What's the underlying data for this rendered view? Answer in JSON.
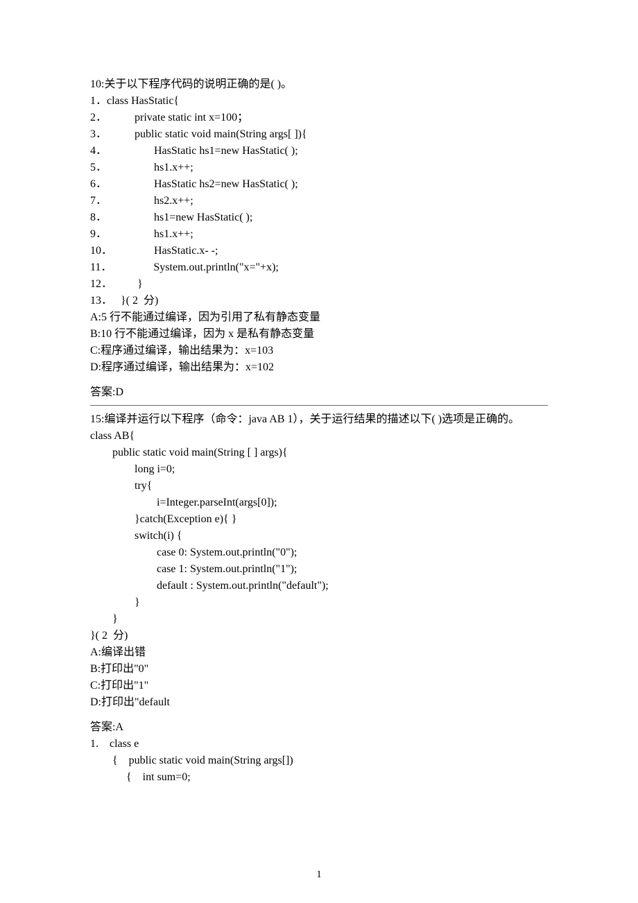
{
  "q10": {
    "stem": "10:关于以下程序代码的说明正确的是( )。",
    "code": [
      "1．class HasStatic{",
      "2．          private static int x=100；",
      "3．          public static void main(String args[ ]){",
      "4．                 HasStatic hs1=new HasStatic( );",
      "5．                 hs1.x++;",
      "6．                 HasStatic hs2=new HasStatic( );",
      "7．                 hs2.x++;",
      "8．                 hs1=new HasStatic( );",
      "9．                 hs1.x++;",
      "10．               HasStatic.x- -;",
      "11．               System.out.println(\"x=\"+x);",
      "12．         }",
      "13．   }( 2  分)"
    ],
    "opts": {
      "A": "A:5 行不能通过编译，因为引用了私有静态变量",
      "B": "B:10 行不能通过编译，因为 x 是私有静态变量",
      "C": "C:程序通过编译，输出结果为：x=103",
      "D": "D:程序通过编译，输出结果为：x=102"
    },
    "answer": "答案:D"
  },
  "q15": {
    "stem": "15:编译并运行以下程序（命令：java AB 1），关于运行结果的描述以下( )选项是正确的。",
    "code": [
      "class AB{",
      "        public static void main(String [ ] args){",
      "                long i=0;",
      "                try{",
      "                        i=Integer.parseInt(args[0]);",
      "                }catch(Exception e){ }",
      "                switch(i) {",
      "                        case 0: System.out.println(\"0\");",
      "                        case 1: System.out.println(\"1\");",
      "                        default : System.out.println(\"default\");",
      "                }",
      "        }",
      "}( 2  分)"
    ],
    "opts": {
      "A": "A:编译出错",
      "B": "B:打印出\"0\"",
      "C": "C:打印出\"1\"",
      "D": "D:打印出\"default"
    },
    "answer": "答案:A"
  },
  "tail": {
    "code": [
      "1.    class e",
      "        {    public static void main(String args[])",
      "             {    int sum=0;"
    ]
  },
  "pagenum": "1"
}
